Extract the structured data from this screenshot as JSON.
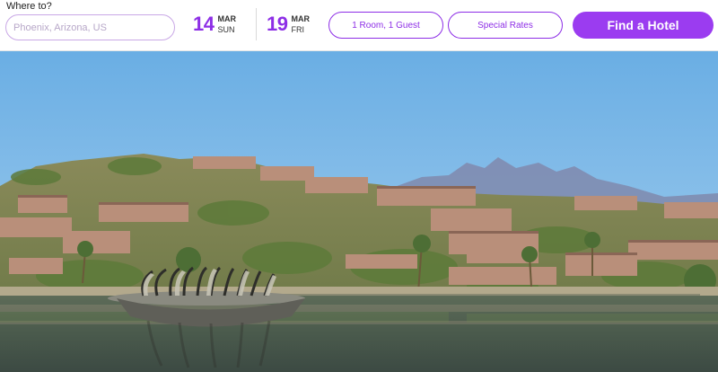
{
  "search": {
    "label": "Where to?",
    "placeholder": "Phoenix, Arizona, US",
    "value": ""
  },
  "checkin": {
    "day": "14",
    "month": "MAR",
    "weekday": "SUN"
  },
  "checkout": {
    "day": "19",
    "month": "MAR",
    "weekday": "FRI"
  },
  "rooms_guests_label": "1 Room, 1 Guest",
  "special_rates_label": "Special Rates",
  "find_hotel_label": "Find a Hotel",
  "colors": {
    "accent": "#8d2ee6",
    "button_fill": "#9b3cf0",
    "sky": "#77b6e6",
    "water": "#4a5a4c"
  },
  "hero": {
    "icons": [
      "desert-resort-photo",
      "fountain-sculpture"
    ]
  }
}
